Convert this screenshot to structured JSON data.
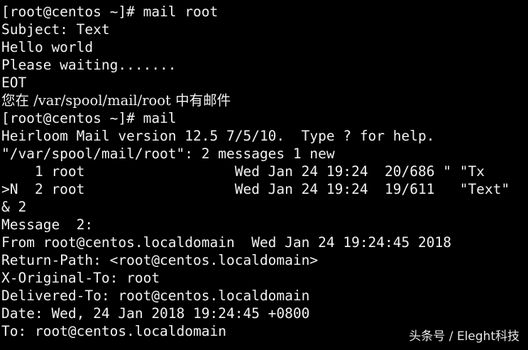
{
  "terminal": {
    "lines": [
      "[root@centos ~]# mail root",
      "Subject: Text",
      "Hello world",
      "Please waiting.......",
      "EOT",
      "您在 /var/spool/mail/root 中有邮件",
      "[root@centos ~]# mail",
      "Heirloom Mail version 12.5 7/5/10.  Type ? for help.",
      "\"/var/spool/mail/root\": 2 messages 1 new",
      "    1 root                  Wed Jan 24 19:24  20/686 \" \"Tx",
      ">N  2 root                  Wed Jan 24 19:24  19/611   \"Text\"",
      "& 2",
      "Message  2:",
      "From root@centos.localdomain  Wed Jan 24 19:24:45 2018",
      "Return-Path: <root@centos.localdomain>",
      "X-Original-To: root",
      "Delivered-To: root@centos.localdomain",
      "Date: Wed, 24 Jan 2018 19:24:45 +0800",
      "To: root@centos.localdomain"
    ]
  },
  "watermark": {
    "text": "头条号 / Eleght科技"
  },
  "colors": {
    "background": "#000000",
    "foreground": "#f2f2f2"
  }
}
